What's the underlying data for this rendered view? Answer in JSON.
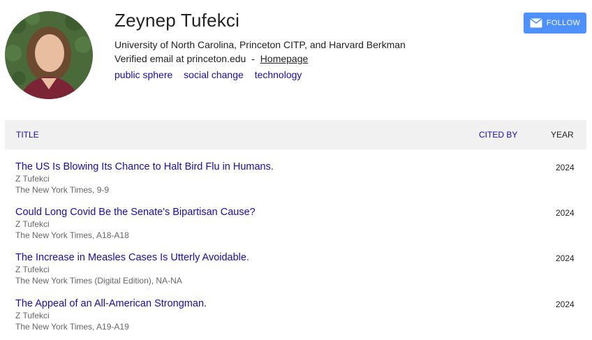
{
  "profile": {
    "name": "Zeynep Tufekci",
    "affiliation": "University of North Carolina, Princeton CITP, and Harvard Berkman",
    "email_text": "Verified email at princeton.edu",
    "separator": "-",
    "homepage_label": "Homepage",
    "interests": [
      "public sphere",
      "social change",
      "technology"
    ]
  },
  "follow_button": {
    "label": "FOLLOW",
    "icon": "mail-icon"
  },
  "table": {
    "headers": {
      "title": "TITLE",
      "cited_by": "CITED BY",
      "year": "YEAR"
    },
    "rows": [
      {
        "title": "The US Is Blowing Its Chance to Halt Bird Flu in Humans.",
        "authors": "Z Tufekci",
        "venue": "The New York Times, 9-9",
        "year": "2024"
      },
      {
        "title": "Could Long Covid Be the Senate's Bipartisan Cause?",
        "authors": "Z Tufekci",
        "venue": "The New York Times, A18-A18",
        "year": "2024"
      },
      {
        "title": "The Increase in Measles Cases Is Utterly Avoidable.",
        "authors": "Z Tufekci",
        "venue": "The New York Times (Digital Edition), NA-NA",
        "year": "2024"
      },
      {
        "title": "The Appeal of an All-American Strongman.",
        "authors": "Z Tufekci",
        "venue": "The New York Times, A19-A19",
        "year": "2024"
      }
    ]
  },
  "colors": {
    "link": "#1a0dab",
    "button": "#4d90fe",
    "header_bg": "#f1f1f1"
  }
}
